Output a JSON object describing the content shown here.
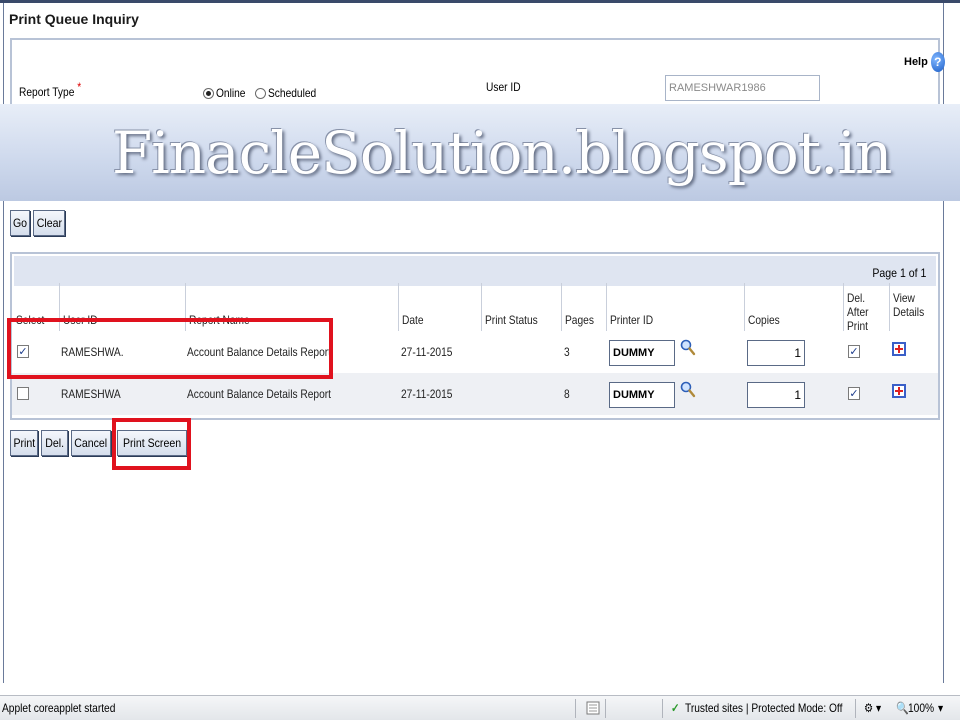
{
  "page": {
    "title": "Print Queue Inquiry"
  },
  "help": {
    "label": "Help",
    "icon": "help-question-icon"
  },
  "criteria": {
    "report_type_label": "Report Type",
    "required_mark": "*",
    "options": [
      {
        "label": "Online",
        "selected": true
      },
      {
        "label": "Scheduled",
        "selected": false
      }
    ],
    "user_id_label": "User ID",
    "user_id_value": "RAMESHWAR1986"
  },
  "watermark": {
    "text": "FinacleSolution.blogspot.in"
  },
  "search_buttons": {
    "go": "Go",
    "clear": "Clear"
  },
  "results": {
    "page_info": "Page 1 of 1",
    "columns": {
      "select": "Select",
      "user_id": "User ID",
      "report_name": "Report Name",
      "date": "Date",
      "print_status": "Print Status",
      "pages": "Pages",
      "printer_id": "Printer ID",
      "copies": "Copies",
      "del_after_print": "Del. After Print",
      "view_details": "View Details"
    },
    "rows": [
      {
        "selected": true,
        "user_id": "RAMESHWA.",
        "report_name": "Account Balance Details Report",
        "date": "27-11-2015",
        "print_status": "",
        "pages": "3",
        "printer_id": "DUMMY",
        "copies": "1",
        "del_after_print": true
      },
      {
        "selected": false,
        "user_id": "RAMESHWA",
        "report_name": "Account Balance Details Report",
        "date": "27-11-2015",
        "print_status": "",
        "pages": "8",
        "printer_id": "DUMMY",
        "copies": "1",
        "del_after_print": true
      }
    ]
  },
  "action_buttons": {
    "print": "Print",
    "del": "Del.",
    "cancel": "Cancel",
    "print_screen": "Print Screen"
  },
  "status_bar": {
    "message": "Applet coreapplet started",
    "zone": "Trusted sites | Protected Mode: Off",
    "zoom": "100%"
  },
  "colors": {
    "highlight": "#e0121e",
    "header_band": "#dfe5f1",
    "alt_row": "#eef0f4"
  }
}
